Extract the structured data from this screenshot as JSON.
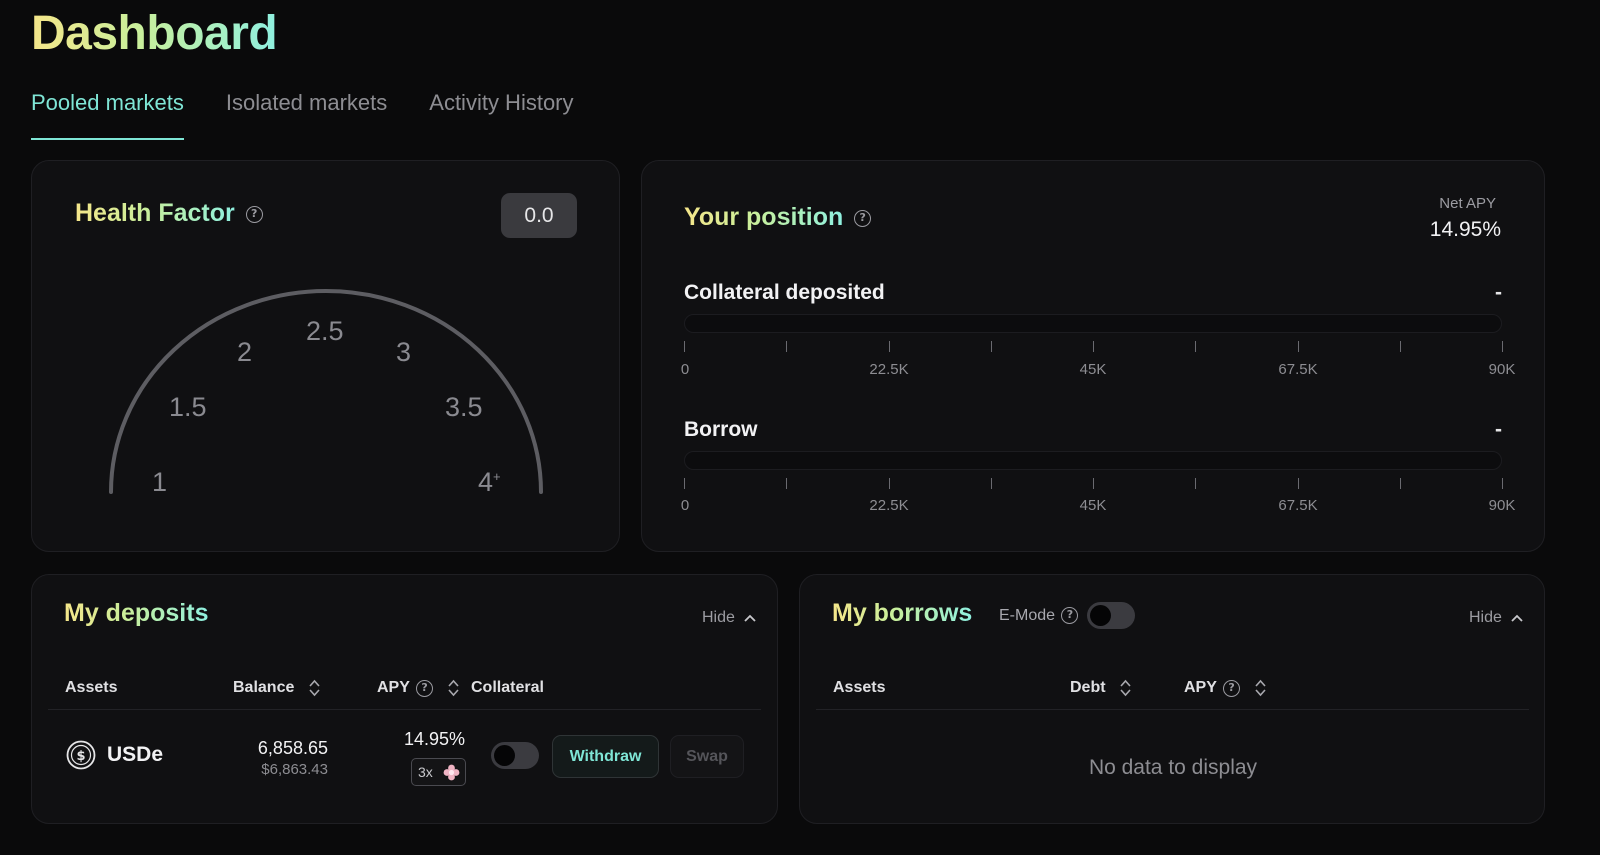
{
  "page": {
    "title": "Dashboard"
  },
  "tabs": [
    {
      "label": "Pooled markets",
      "active": true
    },
    {
      "label": "Isolated markets",
      "active": false
    },
    {
      "label": "Activity History",
      "active": false
    }
  ],
  "health": {
    "title": "Health Factor",
    "value": "0.0",
    "gauge_labels": [
      "1",
      "1.5",
      "2",
      "2.5",
      "3",
      "3.5",
      "4"
    ],
    "gauge_max_suffix": "+"
  },
  "position": {
    "title": "Your position",
    "net_apy_label": "Net APY",
    "net_apy_value": "14.95%",
    "collateral": {
      "label": "Collateral deposited",
      "value": "-"
    },
    "borrow": {
      "label": "Borrow",
      "value": "-"
    },
    "axis_labels": [
      "0",
      "22.5K",
      "45K",
      "67.5K",
      "90K"
    ]
  },
  "deposits": {
    "title": "My deposits",
    "hide_label": "Hide",
    "columns": {
      "assets": "Assets",
      "balance": "Balance",
      "apy": "APY",
      "collateral": "Collateral"
    },
    "rows": [
      {
        "asset": "USDe",
        "asset_icon": "dollar-coin-icon",
        "balance": "6,858.65",
        "balance_usd": "$6,863.43",
        "apy": "14.95%",
        "multiplier": "3x",
        "collateral_enabled": false,
        "withdraw_label": "Withdraw",
        "swap_label": "Swap"
      }
    ]
  },
  "borrows": {
    "title": "My borrows",
    "emode_label": "E-Mode",
    "emode_enabled": false,
    "hide_label": "Hide",
    "columns": {
      "assets": "Assets",
      "debt": "Debt",
      "apy": "APY"
    },
    "empty_text": "No data to display"
  },
  "colors": {
    "accent": "#7fe6d6",
    "gradient_start": "#f5e68a",
    "gradient_end": "#8ff0e0",
    "background": "#0a0a0b",
    "card": "#101012"
  }
}
